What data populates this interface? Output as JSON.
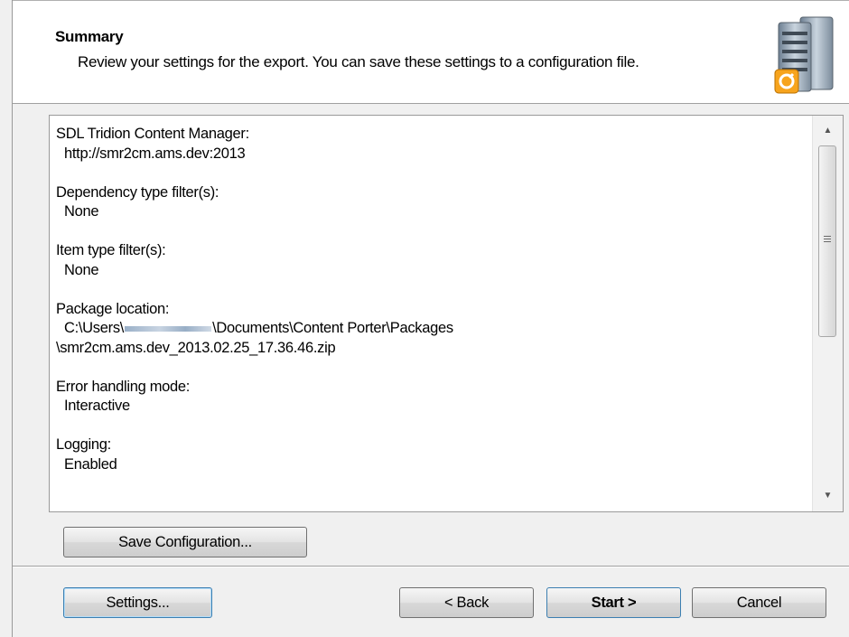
{
  "header": {
    "title": "Summary",
    "subtitle": "Review your settings for the export. You can save these settings to a configuration file.",
    "icon": "server-stack-icon"
  },
  "summary": {
    "cm_label": "SDL Tridion Content Manager:",
    "cm_value": "http://smr2cm.ams.dev:2013",
    "dep_label": "Dependency type filter(s):",
    "dep_value": "None",
    "item_label": "Item type filter(s):",
    "item_value": "None",
    "pkg_label": "Package location:",
    "pkg_prefix": "C:\\Users\\",
    "pkg_suffix": "\\Documents\\Content Porter\\Packages",
    "pkg_file": "\\smr2cm.ams.dev_2013.02.25_17.36.46.zip",
    "err_label": "Error handling mode:",
    "err_value": "Interactive",
    "log_label": "Logging:",
    "log_value": "Enabled"
  },
  "buttons": {
    "save_config": "Save Configuration...",
    "settings": "Settings...",
    "back": "< Back",
    "start": "Start >",
    "cancel": "Cancel"
  },
  "colors": {
    "window_bg": "#f0f0f0",
    "header_bg": "#ffffff",
    "default_button_border": "#3c7fb1",
    "icon_accent": "#f7a41d"
  }
}
